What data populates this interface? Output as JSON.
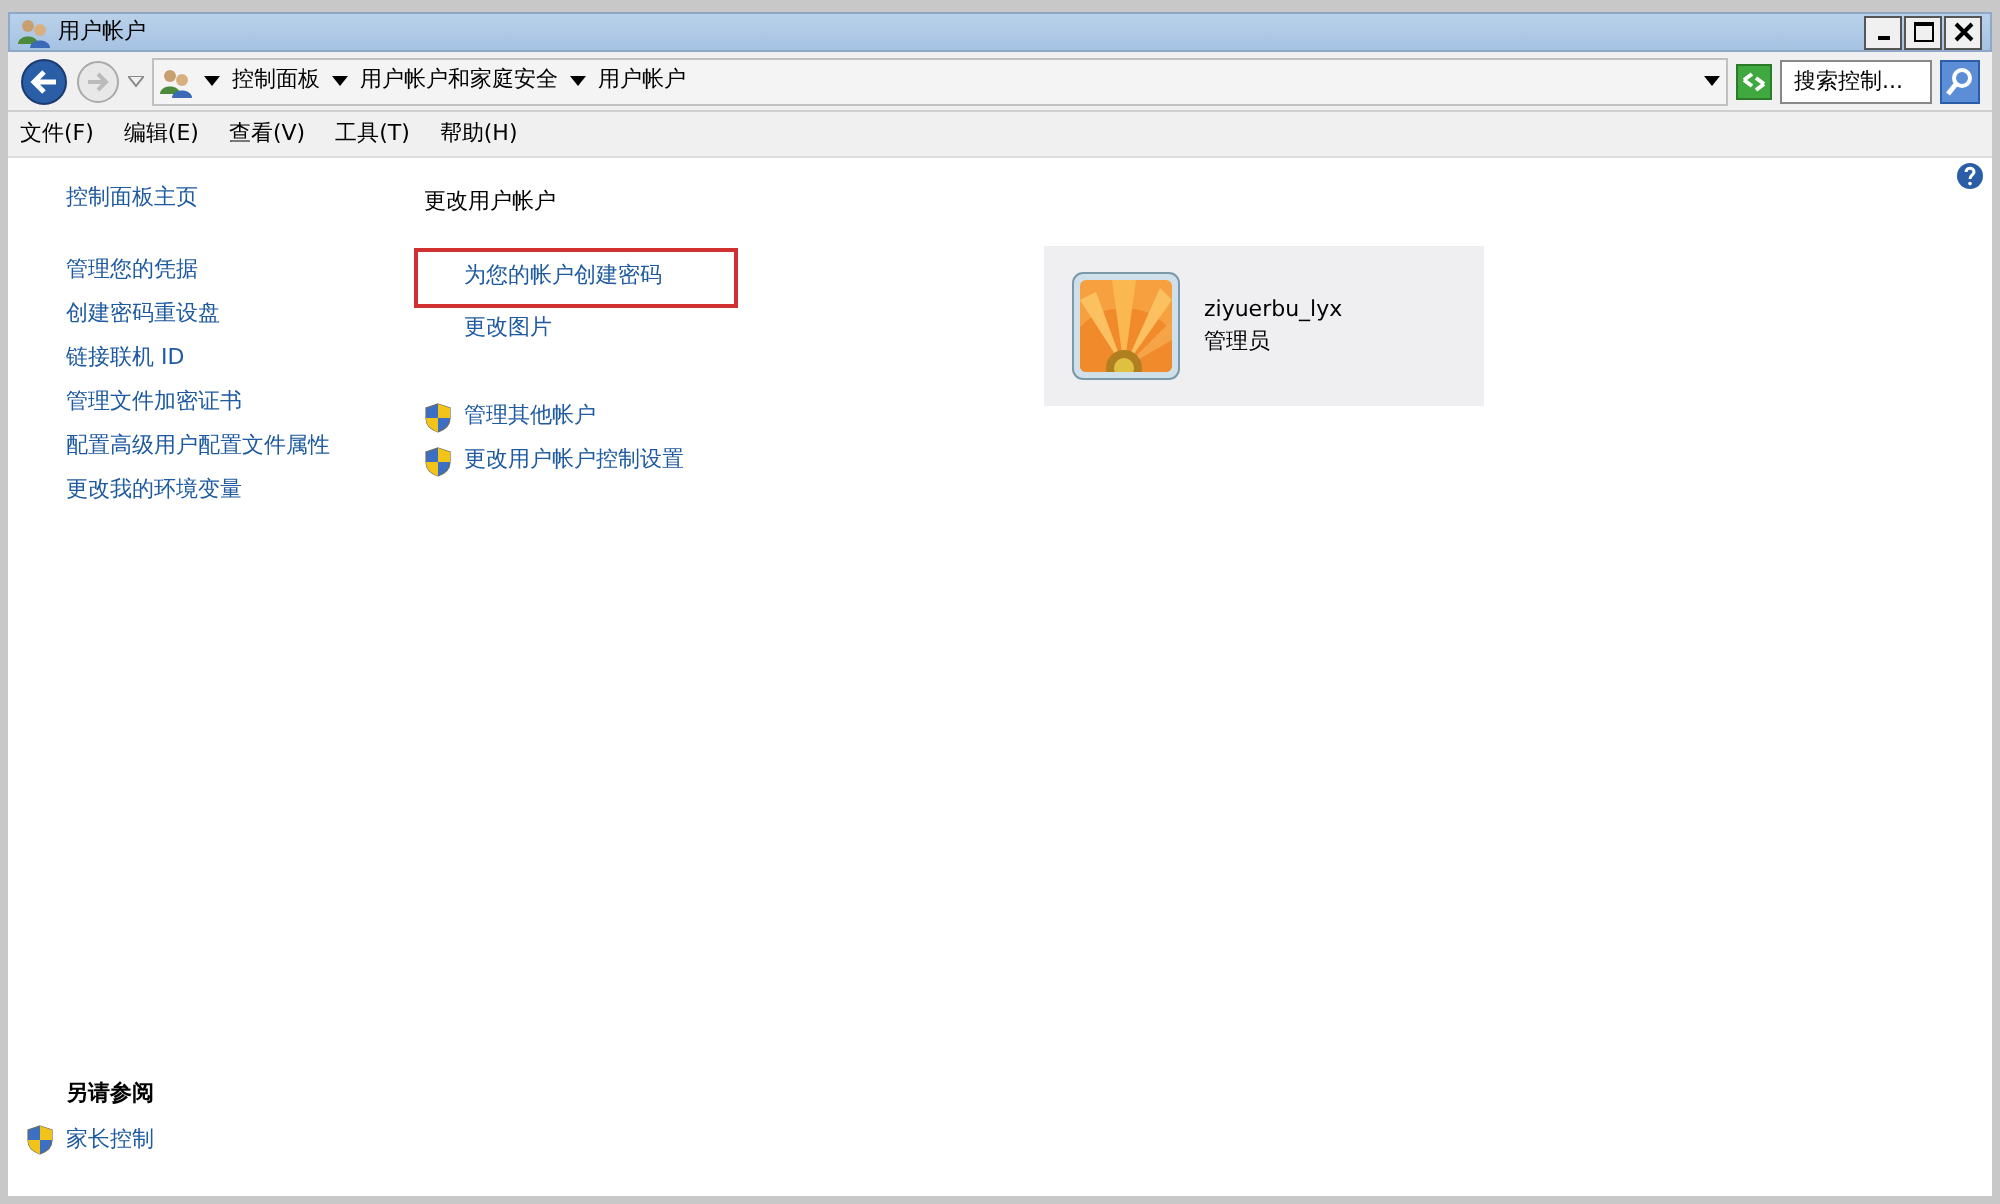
{
  "window": {
    "title": "用户帐户"
  },
  "address_bar": {
    "breadcrumbs": [
      "控制面板",
      "用户帐户和家庭安全",
      "用户帐户"
    ],
    "search": {
      "placeholder": "搜索控制..."
    }
  },
  "menu": [
    "文件(F)",
    "编辑(E)",
    "查看(V)",
    "工具(T)",
    "帮助(H)"
  ],
  "sidebar": {
    "home": "控制面板主页",
    "items": [
      "管理您的凭据",
      "创建密码重设盘",
      "链接联机 ID",
      "管理文件加密证书",
      "配置高级用户配置文件属性",
      "更改我的环境变量"
    ],
    "see_also": {
      "title": "另请参阅",
      "items": [
        {
          "label": "家长控制",
          "kind": "shield"
        }
      ]
    }
  },
  "main": {
    "heading": "更改用户帐户",
    "task_groups": [
      [
        {
          "label": "为您的帐户创建密码",
          "kind": "plain",
          "highlighted": true
        },
        {
          "label": "更改图片",
          "kind": "plain",
          "highlighted": false
        }
      ],
      [
        {
          "label": "管理其他帐户",
          "kind": "shield",
          "highlighted": false
        },
        {
          "label": "更改用户帐户控制设置",
          "kind": "shield",
          "highlighted": false
        }
      ]
    ]
  },
  "account": {
    "name": "ziyuerbu_lyx",
    "role": "管理员"
  }
}
